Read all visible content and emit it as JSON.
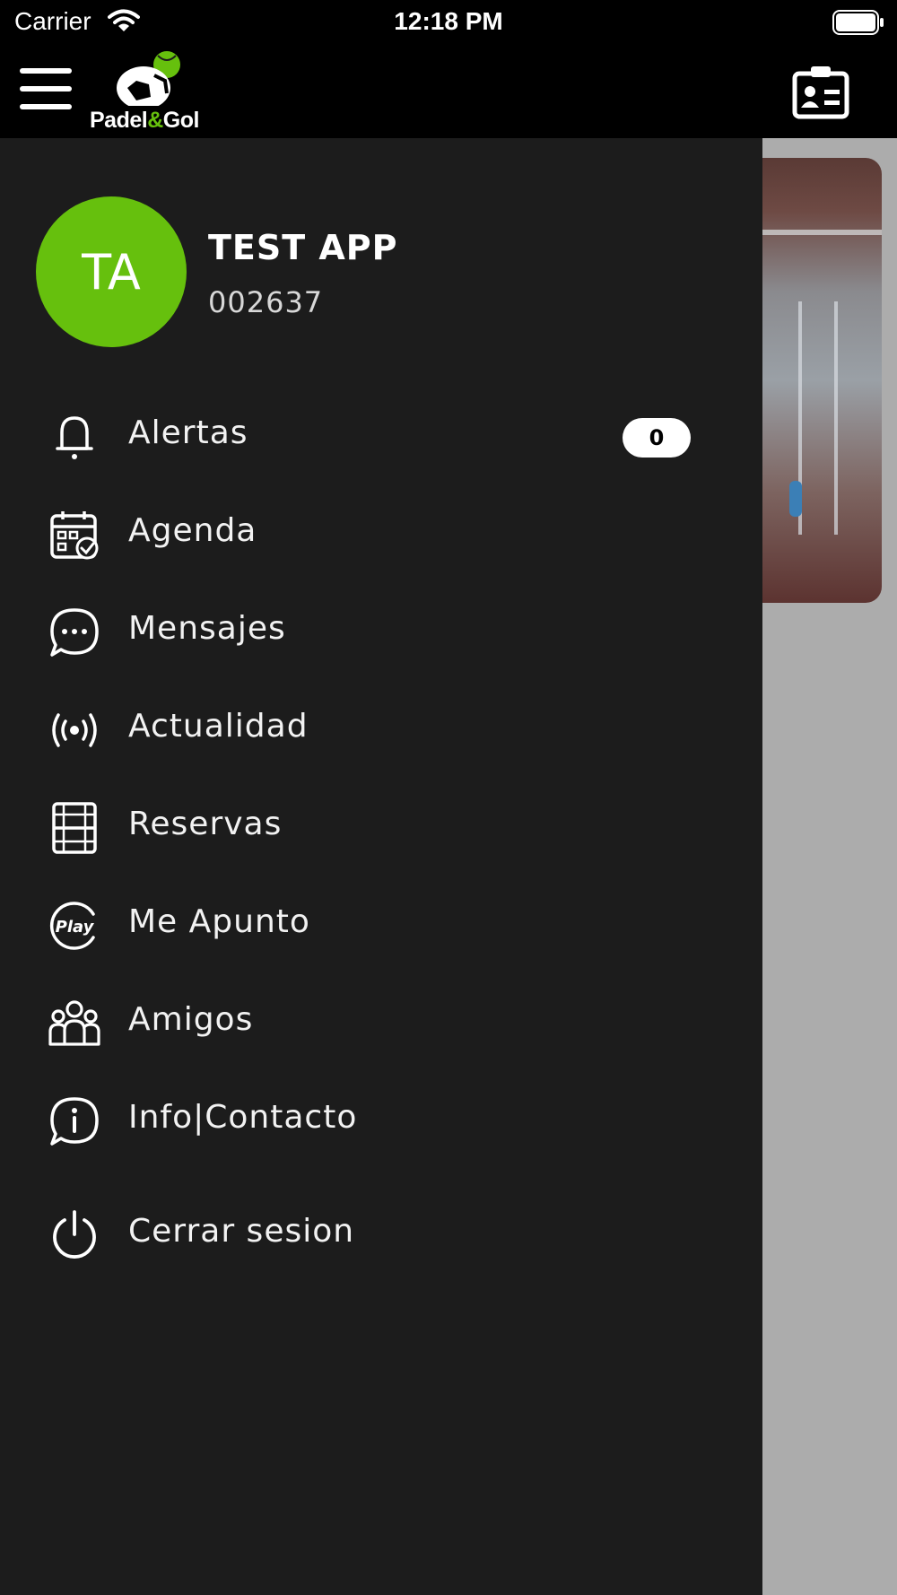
{
  "status_bar": {
    "carrier": "Carrier",
    "time": "12:18 PM"
  },
  "header": {
    "logo_text_1": "Padel",
    "logo_text_amp": "&",
    "logo_text_2": "Gol"
  },
  "profile": {
    "initials": "TA",
    "name": "TEST APP",
    "id": "002637"
  },
  "menu": [
    {
      "label": "Alertas",
      "icon": "bell-icon",
      "badge": "0"
    },
    {
      "label": "Agenda",
      "icon": "calendar-check-icon"
    },
    {
      "label": "Mensajes",
      "icon": "chat-bubble-icon"
    },
    {
      "label": "Actualidad",
      "icon": "broadcast-icon"
    },
    {
      "label": "Reservas",
      "icon": "court-icon"
    },
    {
      "label": "Me Apunto",
      "icon": "play-icon"
    },
    {
      "label": "Amigos",
      "icon": "group-icon"
    },
    {
      "label": "Info|Contacto",
      "icon": "info-chat-icon"
    },
    {
      "label": "Cerrar sesion",
      "icon": "power-icon"
    }
  ],
  "colors": {
    "accent": "#66c00d",
    "drawer_bg": "#1c1c1c",
    "header_bg": "#000000"
  }
}
